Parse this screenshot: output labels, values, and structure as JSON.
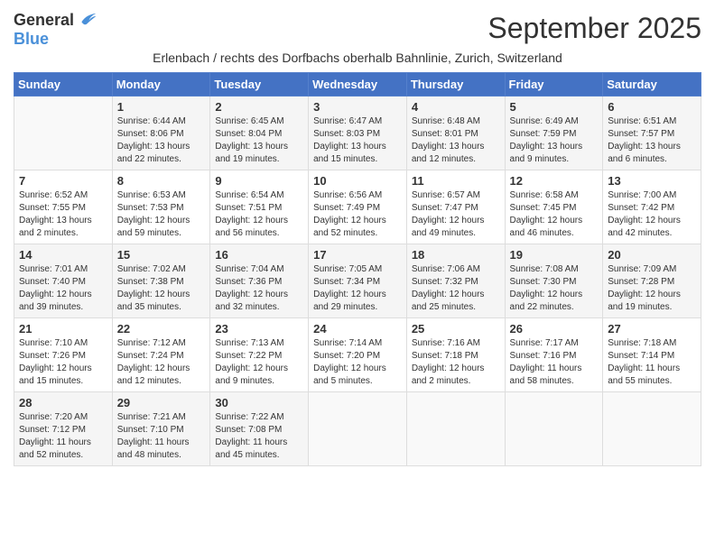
{
  "header": {
    "logo_general": "General",
    "logo_blue": "Blue",
    "title": "September 2025",
    "subtitle": "Erlenbach / rechts des Dorfbachs oberhalb Bahnlinie, Zurich, Switzerland"
  },
  "days_of_week": [
    "Sunday",
    "Monday",
    "Tuesday",
    "Wednesday",
    "Thursday",
    "Friday",
    "Saturday"
  ],
  "weeks": [
    [
      {
        "day": "",
        "sunrise": "",
        "sunset": "",
        "daylight": ""
      },
      {
        "day": "1",
        "sunrise": "Sunrise: 6:44 AM",
        "sunset": "Sunset: 8:06 PM",
        "daylight": "Daylight: 13 hours and 22 minutes."
      },
      {
        "day": "2",
        "sunrise": "Sunrise: 6:45 AM",
        "sunset": "Sunset: 8:04 PM",
        "daylight": "Daylight: 13 hours and 19 minutes."
      },
      {
        "day": "3",
        "sunrise": "Sunrise: 6:47 AM",
        "sunset": "Sunset: 8:03 PM",
        "daylight": "Daylight: 13 hours and 15 minutes."
      },
      {
        "day": "4",
        "sunrise": "Sunrise: 6:48 AM",
        "sunset": "Sunset: 8:01 PM",
        "daylight": "Daylight: 13 hours and 12 minutes."
      },
      {
        "day": "5",
        "sunrise": "Sunrise: 6:49 AM",
        "sunset": "Sunset: 7:59 PM",
        "daylight": "Daylight: 13 hours and 9 minutes."
      },
      {
        "day": "6",
        "sunrise": "Sunrise: 6:51 AM",
        "sunset": "Sunset: 7:57 PM",
        "daylight": "Daylight: 13 hours and 6 minutes."
      }
    ],
    [
      {
        "day": "7",
        "sunrise": "Sunrise: 6:52 AM",
        "sunset": "Sunset: 7:55 PM",
        "daylight": "Daylight: 13 hours and 2 minutes."
      },
      {
        "day": "8",
        "sunrise": "Sunrise: 6:53 AM",
        "sunset": "Sunset: 7:53 PM",
        "daylight": "Daylight: 12 hours and 59 minutes."
      },
      {
        "day": "9",
        "sunrise": "Sunrise: 6:54 AM",
        "sunset": "Sunset: 7:51 PM",
        "daylight": "Daylight: 12 hours and 56 minutes."
      },
      {
        "day": "10",
        "sunrise": "Sunrise: 6:56 AM",
        "sunset": "Sunset: 7:49 PM",
        "daylight": "Daylight: 12 hours and 52 minutes."
      },
      {
        "day": "11",
        "sunrise": "Sunrise: 6:57 AM",
        "sunset": "Sunset: 7:47 PM",
        "daylight": "Daylight: 12 hours and 49 minutes."
      },
      {
        "day": "12",
        "sunrise": "Sunrise: 6:58 AM",
        "sunset": "Sunset: 7:45 PM",
        "daylight": "Daylight: 12 hours and 46 minutes."
      },
      {
        "day": "13",
        "sunrise": "Sunrise: 7:00 AM",
        "sunset": "Sunset: 7:42 PM",
        "daylight": "Daylight: 12 hours and 42 minutes."
      }
    ],
    [
      {
        "day": "14",
        "sunrise": "Sunrise: 7:01 AM",
        "sunset": "Sunset: 7:40 PM",
        "daylight": "Daylight: 12 hours and 39 minutes."
      },
      {
        "day": "15",
        "sunrise": "Sunrise: 7:02 AM",
        "sunset": "Sunset: 7:38 PM",
        "daylight": "Daylight: 12 hours and 35 minutes."
      },
      {
        "day": "16",
        "sunrise": "Sunrise: 7:04 AM",
        "sunset": "Sunset: 7:36 PM",
        "daylight": "Daylight: 12 hours and 32 minutes."
      },
      {
        "day": "17",
        "sunrise": "Sunrise: 7:05 AM",
        "sunset": "Sunset: 7:34 PM",
        "daylight": "Daylight: 12 hours and 29 minutes."
      },
      {
        "day": "18",
        "sunrise": "Sunrise: 7:06 AM",
        "sunset": "Sunset: 7:32 PM",
        "daylight": "Daylight: 12 hours and 25 minutes."
      },
      {
        "day": "19",
        "sunrise": "Sunrise: 7:08 AM",
        "sunset": "Sunset: 7:30 PM",
        "daylight": "Daylight: 12 hours and 22 minutes."
      },
      {
        "day": "20",
        "sunrise": "Sunrise: 7:09 AM",
        "sunset": "Sunset: 7:28 PM",
        "daylight": "Daylight: 12 hours and 19 minutes."
      }
    ],
    [
      {
        "day": "21",
        "sunrise": "Sunrise: 7:10 AM",
        "sunset": "Sunset: 7:26 PM",
        "daylight": "Daylight: 12 hours and 15 minutes."
      },
      {
        "day": "22",
        "sunrise": "Sunrise: 7:12 AM",
        "sunset": "Sunset: 7:24 PM",
        "daylight": "Daylight: 12 hours and 12 minutes."
      },
      {
        "day": "23",
        "sunrise": "Sunrise: 7:13 AM",
        "sunset": "Sunset: 7:22 PM",
        "daylight": "Daylight: 12 hours and 9 minutes."
      },
      {
        "day": "24",
        "sunrise": "Sunrise: 7:14 AM",
        "sunset": "Sunset: 7:20 PM",
        "daylight": "Daylight: 12 hours and 5 minutes."
      },
      {
        "day": "25",
        "sunrise": "Sunrise: 7:16 AM",
        "sunset": "Sunset: 7:18 PM",
        "daylight": "Daylight: 12 hours and 2 minutes."
      },
      {
        "day": "26",
        "sunrise": "Sunrise: 7:17 AM",
        "sunset": "Sunset: 7:16 PM",
        "daylight": "Daylight: 11 hours and 58 minutes."
      },
      {
        "day": "27",
        "sunrise": "Sunrise: 7:18 AM",
        "sunset": "Sunset: 7:14 PM",
        "daylight": "Daylight: 11 hours and 55 minutes."
      }
    ],
    [
      {
        "day": "28",
        "sunrise": "Sunrise: 7:20 AM",
        "sunset": "Sunset: 7:12 PM",
        "daylight": "Daylight: 11 hours and 52 minutes."
      },
      {
        "day": "29",
        "sunrise": "Sunrise: 7:21 AM",
        "sunset": "Sunset: 7:10 PM",
        "daylight": "Daylight: 11 hours and 48 minutes."
      },
      {
        "day": "30",
        "sunrise": "Sunrise: 7:22 AM",
        "sunset": "Sunset: 7:08 PM",
        "daylight": "Daylight: 11 hours and 45 minutes."
      },
      {
        "day": "",
        "sunrise": "",
        "sunset": "",
        "daylight": ""
      },
      {
        "day": "",
        "sunrise": "",
        "sunset": "",
        "daylight": ""
      },
      {
        "day": "",
        "sunrise": "",
        "sunset": "",
        "daylight": ""
      },
      {
        "day": "",
        "sunrise": "",
        "sunset": "",
        "daylight": ""
      }
    ]
  ]
}
